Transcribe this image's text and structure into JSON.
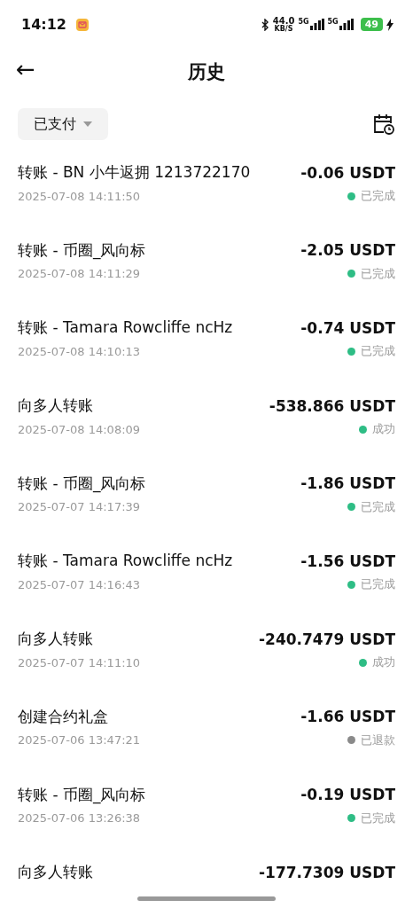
{
  "status_bar": {
    "time": "14:12",
    "speed": "44.0",
    "speed_unit": "KB/S",
    "network_1": "5G",
    "network_2": "5G",
    "battery": "49"
  },
  "header": {
    "back": "←",
    "title": "历史"
  },
  "filter": {
    "label": "已支付"
  },
  "transactions": [
    {
      "title": "转账 - BN 小牛返拥 1213722170",
      "amount": "-0.06 USDT",
      "time": "2025-07-08 14:11:50",
      "status": "已完成",
      "color": "#2ebd85"
    },
    {
      "title": "转账 - 币圈_风向标",
      "amount": "-2.05 USDT",
      "time": "2025-07-08 14:11:29",
      "status": "已完成",
      "color": "#2ebd85"
    },
    {
      "title": "转账 - Tamara Rowcliffe ncHz",
      "amount": "-0.74 USDT",
      "time": "2025-07-08 14:10:13",
      "status": "已完成",
      "color": "#2ebd85"
    },
    {
      "title": "向多人转账",
      "amount": "-538.866 USDT",
      "time": "2025-07-08 14:08:09",
      "status": "成功",
      "color": "#2ebd85"
    },
    {
      "title": "转账 - 币圈_风向标",
      "amount": "-1.86 USDT",
      "time": "2025-07-07 14:17:39",
      "status": "已完成",
      "color": "#2ebd85"
    },
    {
      "title": "转账 - Tamara Rowcliffe ncHz",
      "amount": "-1.56 USDT",
      "time": "2025-07-07 14:16:43",
      "status": "已完成",
      "color": "#2ebd85"
    },
    {
      "title": "向多人转账",
      "amount": "-240.7479 USDT",
      "time": "2025-07-07 14:11:10",
      "status": "成功",
      "color": "#2ebd85"
    },
    {
      "title": "创建合约礼盒",
      "amount": "-1.66 USDT",
      "time": "2025-07-06 13:47:21",
      "status": "已退款",
      "color": "#8a8a8a"
    },
    {
      "title": "转账 - 币圈_风向标",
      "amount": "-0.19 USDT",
      "time": "2025-07-06 13:26:38",
      "status": "已完成",
      "color": "#2ebd85"
    },
    {
      "title": "向多人转账",
      "amount": "-177.7309 USDT"
    }
  ]
}
